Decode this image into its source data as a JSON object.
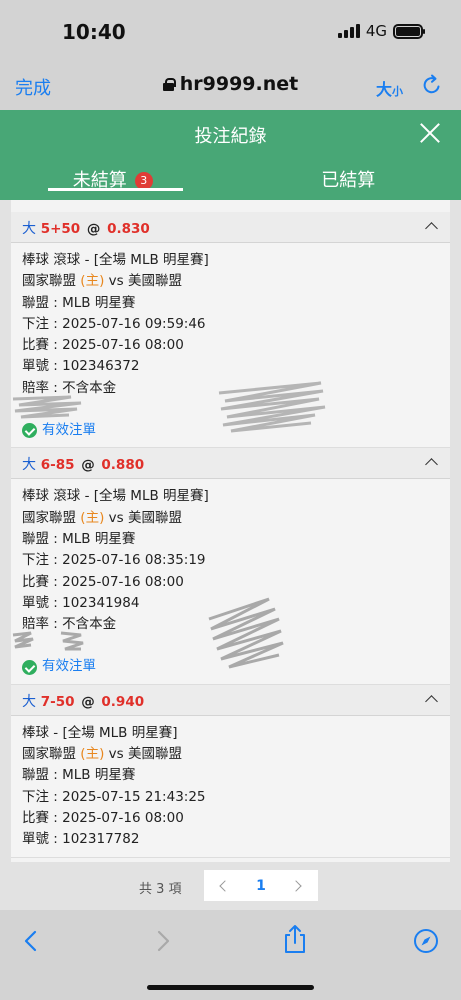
{
  "status": {
    "time": "10:40",
    "network": "4G"
  },
  "browser": {
    "done_label": "完成",
    "url": "hr9999.net",
    "textsize_label": "大",
    "textsize_small": "小"
  },
  "header": {
    "title": "投注紀錄"
  },
  "tabs": {
    "unsettled_label": "未結算",
    "unsettled_count": "3",
    "settled_label": "已結算"
  },
  "bets": [
    {
      "direction": "大",
      "line": "5+50",
      "at": "@",
      "odds": "0.830",
      "event": "棒球 滾球 - [全場 MLB 明星賽]",
      "home_team": "國家聯盟",
      "home_tag": "(主)",
      "vs": "vs",
      "away_team": "美國聯盟",
      "league": "聯盟 : MLB 明星賽",
      "placed": "下注 : 2025-07-16 09:59:46",
      "match": "比賽 : 2025-07-16 08:00",
      "ticket": "單號 : 102346372",
      "odds_type": "賠率 : 不含本金",
      "status": "有效注單"
    },
    {
      "direction": "大",
      "line": "6-85",
      "at": "@",
      "odds": "0.880",
      "event": "棒球 滾球 - [全場 MLB 明星賽]",
      "home_team": "國家聯盟",
      "home_tag": "(主)",
      "vs": "vs",
      "away_team": "美國聯盟",
      "league": "聯盟 : MLB 明星賽",
      "placed": "下注 : 2025-07-16 08:35:19",
      "match": "比賽 : 2025-07-16 08:00",
      "ticket": "單號 : 102341984",
      "odds_type": "賠率 : 不含本金",
      "status": "有效注單"
    },
    {
      "direction": "大",
      "line": "7-50",
      "at": "@",
      "odds": "0.940",
      "event": "棒球 - [全場 MLB 明星賽]",
      "home_team": "國家聯盟",
      "home_tag": "(主)",
      "vs": "vs",
      "away_team": "美國聯盟",
      "league": "聯盟 : MLB 明星賽",
      "placed": "下注 : 2025-07-15 21:43:25",
      "match": "比賽 : 2025-07-16 08:00",
      "ticket": "單號 : 102317782"
    }
  ],
  "pager": {
    "total": "共 3 項",
    "page": "1"
  },
  "colors": {
    "accent_green": "#48a776",
    "link_blue": "#1a7ef0",
    "odds_red": "#e0302a",
    "home_orange": "#e8871e"
  },
  "icons": [
    "lock-icon",
    "reload-icon",
    "close-icon",
    "chevron-up-icon",
    "check-icon",
    "back-icon",
    "forward-icon",
    "share-icon",
    "compass-icon"
  ]
}
